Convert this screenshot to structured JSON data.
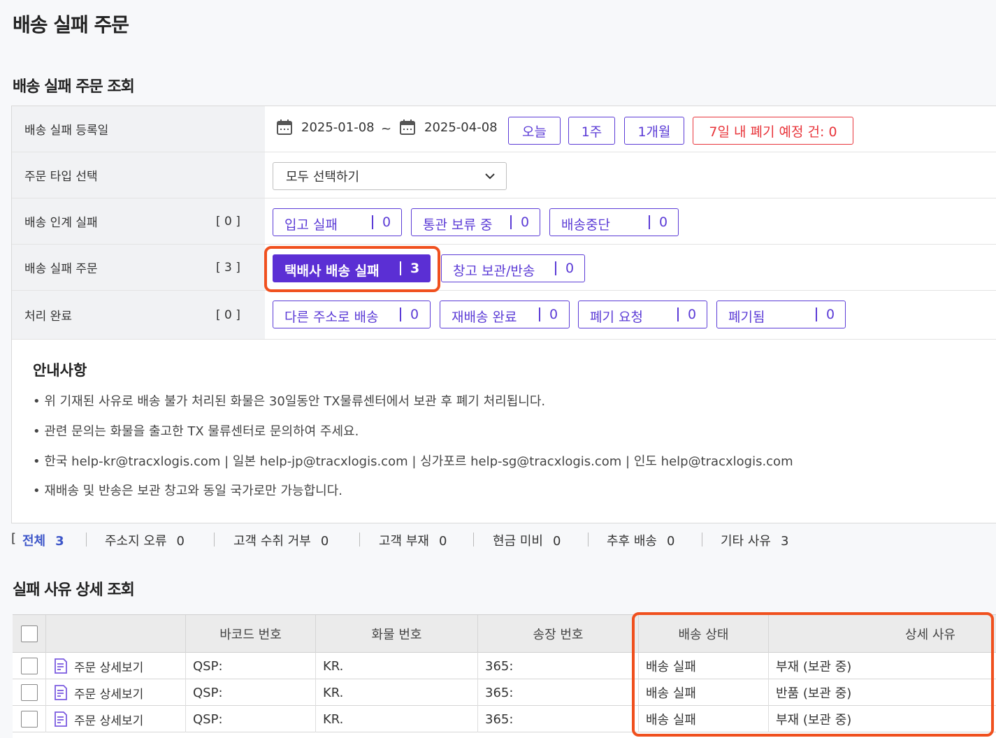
{
  "page": {
    "title": "배송 실패 주문",
    "search_title": "배송 실패 주문 조회",
    "detail_title": "실패 사유 상세 조회"
  },
  "search": {
    "date_label": "배송 실패 등록일",
    "date_from": "2025-01-08",
    "date_sep": "~",
    "date_to": "2025-04-08",
    "quick_today": "오늘",
    "quick_week": "1주",
    "quick_month": "1개월",
    "dispose_soon": "7일 내 폐기 예정 건: 0",
    "order_type_label": "주문 타입 선택",
    "order_type_value": "모두 선택하기",
    "handover_label": "배송 인계 실패",
    "handover_count": "[ 0 ]",
    "handover_items": [
      {
        "label": "입고 실패",
        "count": "0"
      },
      {
        "label": "통관 보류 중",
        "count": "0"
      },
      {
        "label": "배송중단",
        "count": "0"
      }
    ],
    "failed_label": "배송 실패 주문",
    "failed_count": "[ 3 ]",
    "failed_items": [
      {
        "label": "택배사 배송 실패",
        "count": "3"
      },
      {
        "label": "창고 보관/반송",
        "count": "0"
      }
    ],
    "done_label": "처리 완료",
    "done_count": "[ 0 ]",
    "done_items": [
      {
        "label": "다른 주소로 배송",
        "count": "0"
      },
      {
        "label": "재배송 완료",
        "count": "0"
      },
      {
        "label": "폐기 요청",
        "count": "0"
      },
      {
        "label": "폐기됨",
        "count": "0"
      }
    ]
  },
  "notice": {
    "title": "안내사항",
    "lines": [
      "• 위 기재된 사유로 배송 불가 처리된 화물은 30일동안 TX물류센터에서 보관 후 폐기 처리됩니다.",
      "• 관련 문의는 화물을 출고한 TX 물류센터로 문의하여 주세요.",
      "• 한국 help-kr@tracxlogis.com | 일본 help-jp@tracxlogis.com | 싱가포르 help-sg@tracxlogis.com | 인도 help@tracxlogis.com",
      "• 재배송 및 반송은 보관 창고와 동일 국가로만 가능합니다."
    ]
  },
  "filters": {
    "bracket": "[",
    "items": [
      {
        "label": "전체",
        "count": "3"
      },
      {
        "label": "주소지 오류",
        "count": "0"
      },
      {
        "label": "고객 수취 거부",
        "count": "0"
      },
      {
        "label": "고객 부재",
        "count": "0"
      },
      {
        "label": "현금 미비",
        "count": "0"
      },
      {
        "label": "추후 배송",
        "count": "0"
      },
      {
        "label": "기타 사유",
        "count": "3"
      }
    ]
  },
  "table": {
    "headers": [
      "바코드 번호",
      "화물 번호",
      "송장 번호",
      "배송 상태",
      "상세 사유"
    ],
    "detail_link": "주문 상세보기",
    "rows": [
      {
        "barcode": "QSP:",
        "cargo": "KR.",
        "invoice": "365:",
        "status": "배송 실패",
        "reason": "부재 (보관 중)"
      },
      {
        "barcode": "QSP:",
        "cargo": "KR.",
        "invoice": "365:",
        "status": "배송 실패",
        "reason": "반품 (보관 중)"
      },
      {
        "barcode": "QSP:",
        "cargo": "KR.",
        "invoice": "365:",
        "status": "배송 실패",
        "reason": "부재 (보관 중)"
      }
    ]
  },
  "colors": {
    "accent": "#5b3bd6",
    "danger": "#e8343a",
    "highlight": "#f0501e"
  }
}
